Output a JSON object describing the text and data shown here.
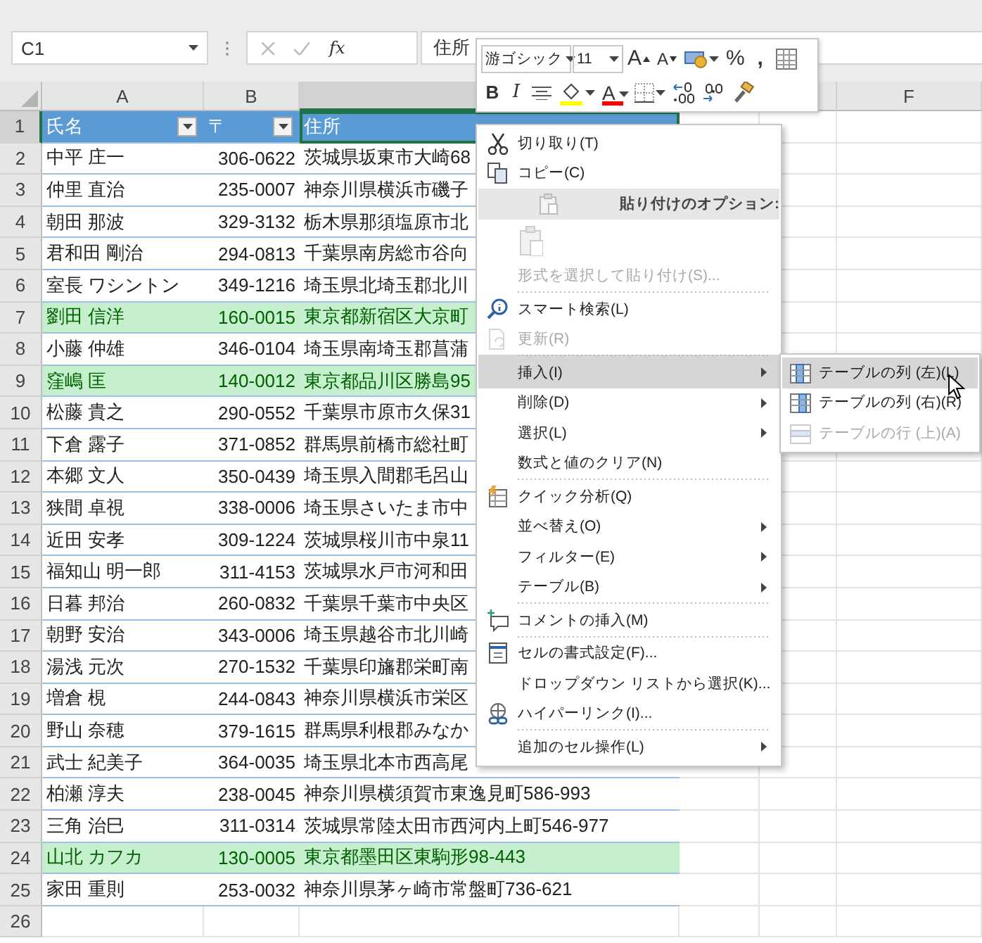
{
  "formula_bar": {
    "name_box": "C1",
    "function_button": "fx",
    "formula": "住所"
  },
  "mini_toolbar": {
    "font_field": "游ゴシック",
    "size_field": "11",
    "row_1": [
      {
        "kind": "grow",
        "label": "A"
      },
      {
        "kind": "shrink",
        "label": "A"
      },
      {
        "kind": "accounting"
      },
      {
        "kind": "percent",
        "label": "%"
      },
      {
        "kind": "comma",
        "label": ","
      },
      {
        "kind": "table"
      }
    ],
    "row_2": [
      {
        "kind": "bold",
        "label": "B"
      },
      {
        "kind": "italic",
        "label": "I"
      },
      {
        "kind": "align"
      },
      {
        "kind": "fill"
      },
      {
        "kind": "font-color",
        "label": "A"
      },
      {
        "kind": "borders"
      },
      {
        "kind": "increase-decimal"
      },
      {
        "kind": "decrease-decimal"
      },
      {
        "kind": "painter"
      }
    ]
  },
  "column_headers": [
    {
      "label": "A",
      "selected": false
    },
    {
      "label": "B",
      "selected": false
    },
    {
      "selected": true
    },
    {
      "selected": false
    },
    {
      "label": "F",
      "selected": false
    }
  ],
  "row_headers": [
    {
      "label": "1",
      "selected": true
    },
    {
      "label": "2",
      "selected": false
    },
    {
      "label": "3",
      "selected": false
    },
    {
      "label": "4",
      "selected": false
    },
    {
      "label": "5",
      "selected": false
    },
    {
      "label": "6",
      "selected": false
    },
    {
      "label": "7",
      "selected": false
    },
    {
      "label": "8",
      "selected": false
    },
    {
      "label": "9",
      "selected": false
    },
    {
      "label": "10",
      "selected": false
    },
    {
      "label": "11",
      "selected": false
    },
    {
      "label": "12",
      "selected": false
    },
    {
      "label": "13",
      "selected": false
    },
    {
      "label": "14",
      "selected": false
    },
    {
      "label": "15",
      "selected": false
    },
    {
      "label": "16",
      "selected": false
    },
    {
      "label": "17",
      "selected": false
    },
    {
      "label": "18",
      "selected": false
    },
    {
      "label": "19",
      "selected": false
    },
    {
      "label": "20",
      "selected": false
    },
    {
      "label": "21",
      "selected": false
    },
    {
      "label": "22",
      "selected": false
    },
    {
      "label": "23",
      "selected": false
    },
    {
      "label": "24",
      "selected": false
    },
    {
      "label": "25",
      "selected": false
    },
    {
      "label": "26",
      "selected": false
    }
  ],
  "table": {
    "columns": [
      {
        "label": "氏名",
        "filter_button": true,
        "selected": false
      },
      {
        "label": "〒",
        "filter_button": true,
        "selected": false
      },
      {
        "label": "住所",
        "filter_button": false,
        "selected": true
      }
    ],
    "rows": [
      {
        "cells": [
          "中平 庄一",
          "306-0622",
          "茨城県坂東市大崎68"
        ],
        "highlighted": false
      },
      {
        "cells": [
          "仲里 直治",
          "235-0007",
          "神奈川県横浜市磯子"
        ],
        "highlighted": false
      },
      {
        "cells": [
          "朝田 那波",
          "329-3132",
          "栃木県那須塩原市北"
        ],
        "highlighted": false
      },
      {
        "cells": [
          "君和田 剛治",
          "294-0813",
          "千葉県南房総市谷向"
        ],
        "highlighted": false
      },
      {
        "cells": [
          "室長 ワシントン",
          "349-1216",
          "埼玉県北埼玉郡北川"
        ],
        "highlighted": false
      },
      {
        "cells": [
          "劉田 信洋",
          "160-0015",
          "東京都新宿区大京町"
        ],
        "highlighted": true
      },
      {
        "cells": [
          "小藤 仲雄",
          "346-0104",
          "埼玉県南埼玉郡菖蒲"
        ],
        "highlighted": false
      },
      {
        "cells": [
          "窪嶋 匡",
          "140-0012",
          "東京都品川区勝島95"
        ],
        "highlighted": true
      },
      {
        "cells": [
          "松藤 貴之",
          "290-0552",
          "千葉県市原市久保31"
        ],
        "highlighted": false
      },
      {
        "cells": [
          "下倉 露子",
          "371-0852",
          "群馬県前橋市総社町"
        ],
        "highlighted": false
      },
      {
        "cells": [
          "本郷 文人",
          "350-0439",
          "埼玉県入間郡毛呂山"
        ],
        "highlighted": false
      },
      {
        "cells": [
          "狭間 卓視",
          "338-0006",
          "埼玉県さいたま市中"
        ],
        "highlighted": false
      },
      {
        "cells": [
          "近田 安孝",
          "309-1224",
          "茨城県桜川市中泉11"
        ],
        "highlighted": false
      },
      {
        "cells": [
          "福知山 明一郎",
          "311-4153",
          "茨城県水戸市河和田"
        ],
        "highlighted": false
      },
      {
        "cells": [
          "日暮 邦治",
          "260-0832",
          "千葉県千葉市中央区"
        ],
        "highlighted": false
      },
      {
        "cells": [
          "朝野 安治",
          "343-0006",
          "埼玉県越谷市北川崎"
        ],
        "highlighted": false
      },
      {
        "cells": [
          "湯浅 元次",
          "270-1532",
          "千葉県印旛郡栄町南"
        ],
        "highlighted": false
      },
      {
        "cells": [
          "増倉 梘",
          "244-0843",
          "神奈川県横浜市栄区"
        ],
        "highlighted": false
      },
      {
        "cells": [
          "野山 奈穂",
          "379-1615",
          "群馬県利根郡みなか"
        ],
        "highlighted": false
      },
      {
        "cells": [
          "武士 紀美子",
          "364-0035",
          "埼玉県北本市西高尾"
        ],
        "highlighted": false
      },
      {
        "cells": [
          "柏瀬 淳夫",
          "238-0045",
          "神奈川県横須賀市東逸見町586-993"
        ],
        "highlighted": false
      },
      {
        "cells": [
          "三角 治巳",
          "311-0314",
          "茨城県常陸太田市西河内上町546-977"
        ],
        "highlighted": false
      },
      {
        "cells": [
          "山北 カフカ",
          "130-0005",
          "東京都墨田区東駒形98-443"
        ],
        "highlighted": true
      },
      {
        "cells": [
          "家田 重則",
          "253-0032",
          "神奈川県茅ヶ崎市常盤町736-621"
        ],
        "highlighted": false
      }
    ]
  },
  "context_menu": {
    "items": [
      {
        "kind": "item",
        "label": "切り取り(T)",
        "disabled": false,
        "selected": false,
        "submenu": false,
        "separator_before": false
      },
      {
        "kind": "item",
        "label": "コピー(C)",
        "disabled": false,
        "selected": false,
        "submenu": false,
        "separator_before": false
      },
      {
        "kind": "header",
        "label": "貼り付けのオプション:"
      },
      {
        "kind": "paste-options",
        "disabled": true
      },
      {
        "kind": "item",
        "label": "形式を選択して貼り付け(S)...",
        "disabled": true,
        "selected": false,
        "submenu": false,
        "separator_before": false
      },
      {
        "kind": "item",
        "label": "スマート検索(L)",
        "disabled": false,
        "selected": false,
        "submenu": false,
        "separator_before": true
      },
      {
        "kind": "item",
        "label": "更新(R)",
        "disabled": true,
        "selected": false,
        "submenu": false,
        "separator_before": false
      },
      {
        "kind": "item",
        "label": "挿入(I)",
        "disabled": false,
        "selected": true,
        "submenu": true,
        "separator_before": true
      },
      {
        "kind": "item",
        "label": "削除(D)",
        "disabled": false,
        "selected": false,
        "submenu": true,
        "separator_before": false
      },
      {
        "kind": "item",
        "label": "選択(L)",
        "disabled": false,
        "selected": false,
        "submenu": true,
        "separator_before": false
      },
      {
        "kind": "item",
        "label": "数式と値のクリア(N)",
        "disabled": false,
        "selected": false,
        "submenu": false,
        "separator_before": false
      },
      {
        "kind": "item",
        "label": "クイック分析(Q)",
        "disabled": false,
        "selected": false,
        "submenu": false,
        "separator_before": true
      },
      {
        "kind": "item",
        "label": "並べ替え(O)",
        "disabled": false,
        "selected": false,
        "submenu": true,
        "separator_before": false
      },
      {
        "kind": "item",
        "label": "フィルター(E)",
        "disabled": false,
        "selected": false,
        "submenu": true,
        "separator_before": false
      },
      {
        "kind": "item",
        "label": "テーブル(B)",
        "disabled": false,
        "selected": false,
        "submenu": true,
        "separator_before": false
      },
      {
        "kind": "item",
        "label": "コメントの挿入(M)",
        "disabled": false,
        "selected": false,
        "submenu": false,
        "separator_before": true
      },
      {
        "kind": "item",
        "label": "セルの書式設定(F)...",
        "disabled": false,
        "selected": false,
        "submenu": false,
        "separator_before": true
      },
      {
        "kind": "item",
        "label": "ドロップダウン リストから選択(K)...",
        "disabled": false,
        "selected": false,
        "submenu": false,
        "separator_before": false
      },
      {
        "kind": "item",
        "label": "ハイパーリンク(I)...",
        "disabled": false,
        "selected": false,
        "submenu": false,
        "separator_before": false
      },
      {
        "kind": "item",
        "label": "追加のセル操作(L)",
        "disabled": false,
        "selected": false,
        "submenu": true,
        "separator_before": true
      }
    ]
  },
  "submenu": {
    "items": [
      {
        "label": "テーブルの列 (左)(L)",
        "selected": true,
        "disabled": false
      },
      {
        "label": "テーブルの列 (右)(R)",
        "selected": false,
        "disabled": false
      },
      {
        "label": "テーブルの行 (上)(A)",
        "selected": false,
        "disabled": true
      }
    ]
  }
}
